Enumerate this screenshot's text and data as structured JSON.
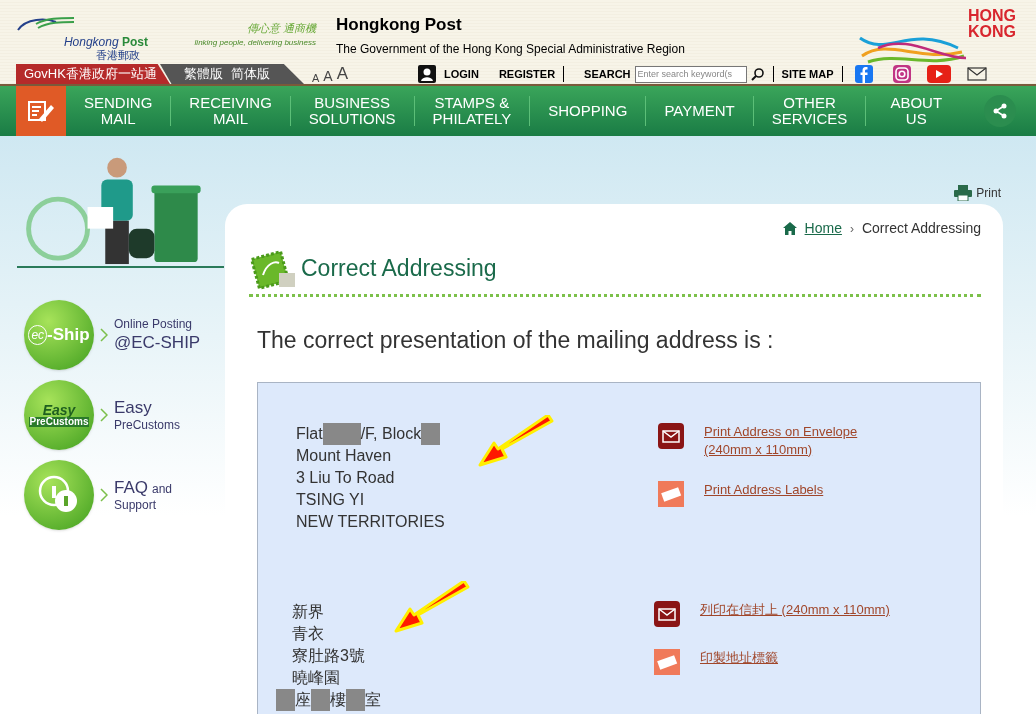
{
  "header": {
    "logo": {
      "name": "Hongkong",
      "name_bold": "Post",
      "name_zh": "香港郵政"
    },
    "slogan": {
      "zh": "傳心意 通商機",
      "en": "linking people, delivering business"
    },
    "title": "Hongkong Post",
    "subtitle": "The Government of the Hong Kong Special Administrative Region",
    "brand": [
      "HONG",
      "KONG"
    ]
  },
  "top_bar": {
    "govhk": "GovHK香港政府一站通",
    "languages": [
      "繁體版",
      "简体版"
    ],
    "font_sizes": [
      "A",
      "A",
      "A"
    ],
    "login": "LOGIN",
    "register": "REGISTER",
    "search_label": "SEARCH",
    "search_placeholder": "Enter search keyword(s",
    "site_map": "SITE MAP"
  },
  "nav": [
    {
      "lines": [
        "SENDING",
        "MAIL"
      ]
    },
    {
      "lines": [
        "RECEIVING",
        "MAIL"
      ]
    },
    {
      "lines": [
        "BUSINESS",
        "SOLUTIONS"
      ]
    },
    {
      "lines": [
        "STAMPS &",
        "PHILATELY"
      ]
    },
    {
      "lines": [
        "SHOPPING"
      ]
    },
    {
      "lines": [
        "PAYMENT"
      ]
    },
    {
      "lines": [
        "OTHER",
        "SERVICES"
      ]
    },
    {
      "lines": [
        "ABOUT",
        "US"
      ]
    }
  ],
  "sidebar": [
    {
      "kind": "ship",
      "badge_text": [
        "ec",
        "-Ship"
      ],
      "lines": [
        [
          {
            "kind": "note",
            "text": "Online Posting"
          }
        ],
        [
          {
            "kind": "title",
            "text": "@EC-SHIP"
          }
        ]
      ]
    },
    {
      "kind": "customs",
      "badge_text": [
        "Easy",
        "PreCustoms"
      ],
      "lines": [
        [
          {
            "kind": "title",
            "text": "Easy"
          }
        ],
        [
          {
            "kind": "note",
            "text": "PreCustoms"
          }
        ]
      ]
    },
    {
      "kind": "help",
      "lines": [
        [
          {
            "kind": "title",
            "text": "FAQ"
          },
          {
            "kind": "note",
            "text": "and"
          }
        ],
        [
          {
            "kind": "note",
            "text": "Support"
          }
        ]
      ]
    }
  ],
  "print": "Print",
  "breadcrumb": {
    "items": [
      "Home",
      "Correct Addressing"
    ],
    "separator": "›"
  },
  "heading": "Correct Addressing",
  "intro": "The correct presentation of the mailing address is :",
  "address_sections": [
    {
      "lines": [
        [
          {
            "kind": "text",
            "text": "Flat"
          },
          {
            "kind": "redaction"
          },
          {
            "kind": "redaction"
          },
          {
            "kind": "text",
            "text": "/F, Block"
          },
          {
            "kind": "redaction"
          }
        ],
        [
          {
            "kind": "text",
            "text": "Mount Haven"
          }
        ],
        [
          {
            "kind": "text",
            "text": "3 Liu To Road"
          }
        ],
        [
          {
            "kind": "text",
            "text": "TSING YI"
          }
        ],
        [
          {
            "kind": "text",
            "text": "NEW TERRITORIES"
          }
        ]
      ],
      "links": [
        {
          "kind": "envelope",
          "text": "Print Address on Envelope (240mm x 110mm)"
        },
        {
          "kind": "label",
          "text": "Print Address Labels"
        }
      ]
    },
    {
      "lines": [
        [
          {
            "kind": "text",
            "text": "新界"
          }
        ],
        [
          {
            "kind": "text",
            "text": "青衣"
          }
        ],
        [
          {
            "kind": "text",
            "text": "寮肚路3號"
          }
        ],
        [
          {
            "kind": "text",
            "text": "曉峰園"
          }
        ],
        [
          {
            "kind": "redaction"
          },
          {
            "kind": "text",
            "text": "座"
          },
          {
            "kind": "redaction"
          },
          {
            "kind": "text",
            "text": "樓"
          },
          {
            "kind": "redaction"
          },
          {
            "kind": "text",
            "text": "室"
          }
        ]
      ],
      "links": [
        {
          "kind": "envelope",
          "text": "列印在信封上 (240mm x 110mm)"
        },
        {
          "kind": "label",
          "text": "印製地址標籤"
        }
      ]
    }
  ]
}
